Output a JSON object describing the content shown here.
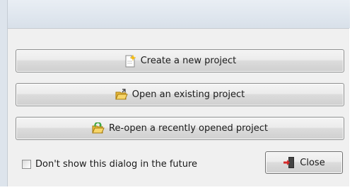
{
  "dialog": {
    "buttons": [
      {
        "label": "Create a new project",
        "icon": "new-document-icon"
      },
      {
        "label": "Open an existing project",
        "icon": "open-folder-icon"
      },
      {
        "label": "Re-open a recently opened project",
        "icon": "reopen-folder-icon"
      }
    ],
    "checkbox": {
      "label": "Don't show this dialog in the future",
      "checked": false
    },
    "close": {
      "label": "Close",
      "icon": "exit-door-icon"
    }
  },
  "colors": {
    "panel_bg": "#f0f0f0",
    "button_border": "#8e8f8f",
    "exit_red": "#d42b2b"
  }
}
